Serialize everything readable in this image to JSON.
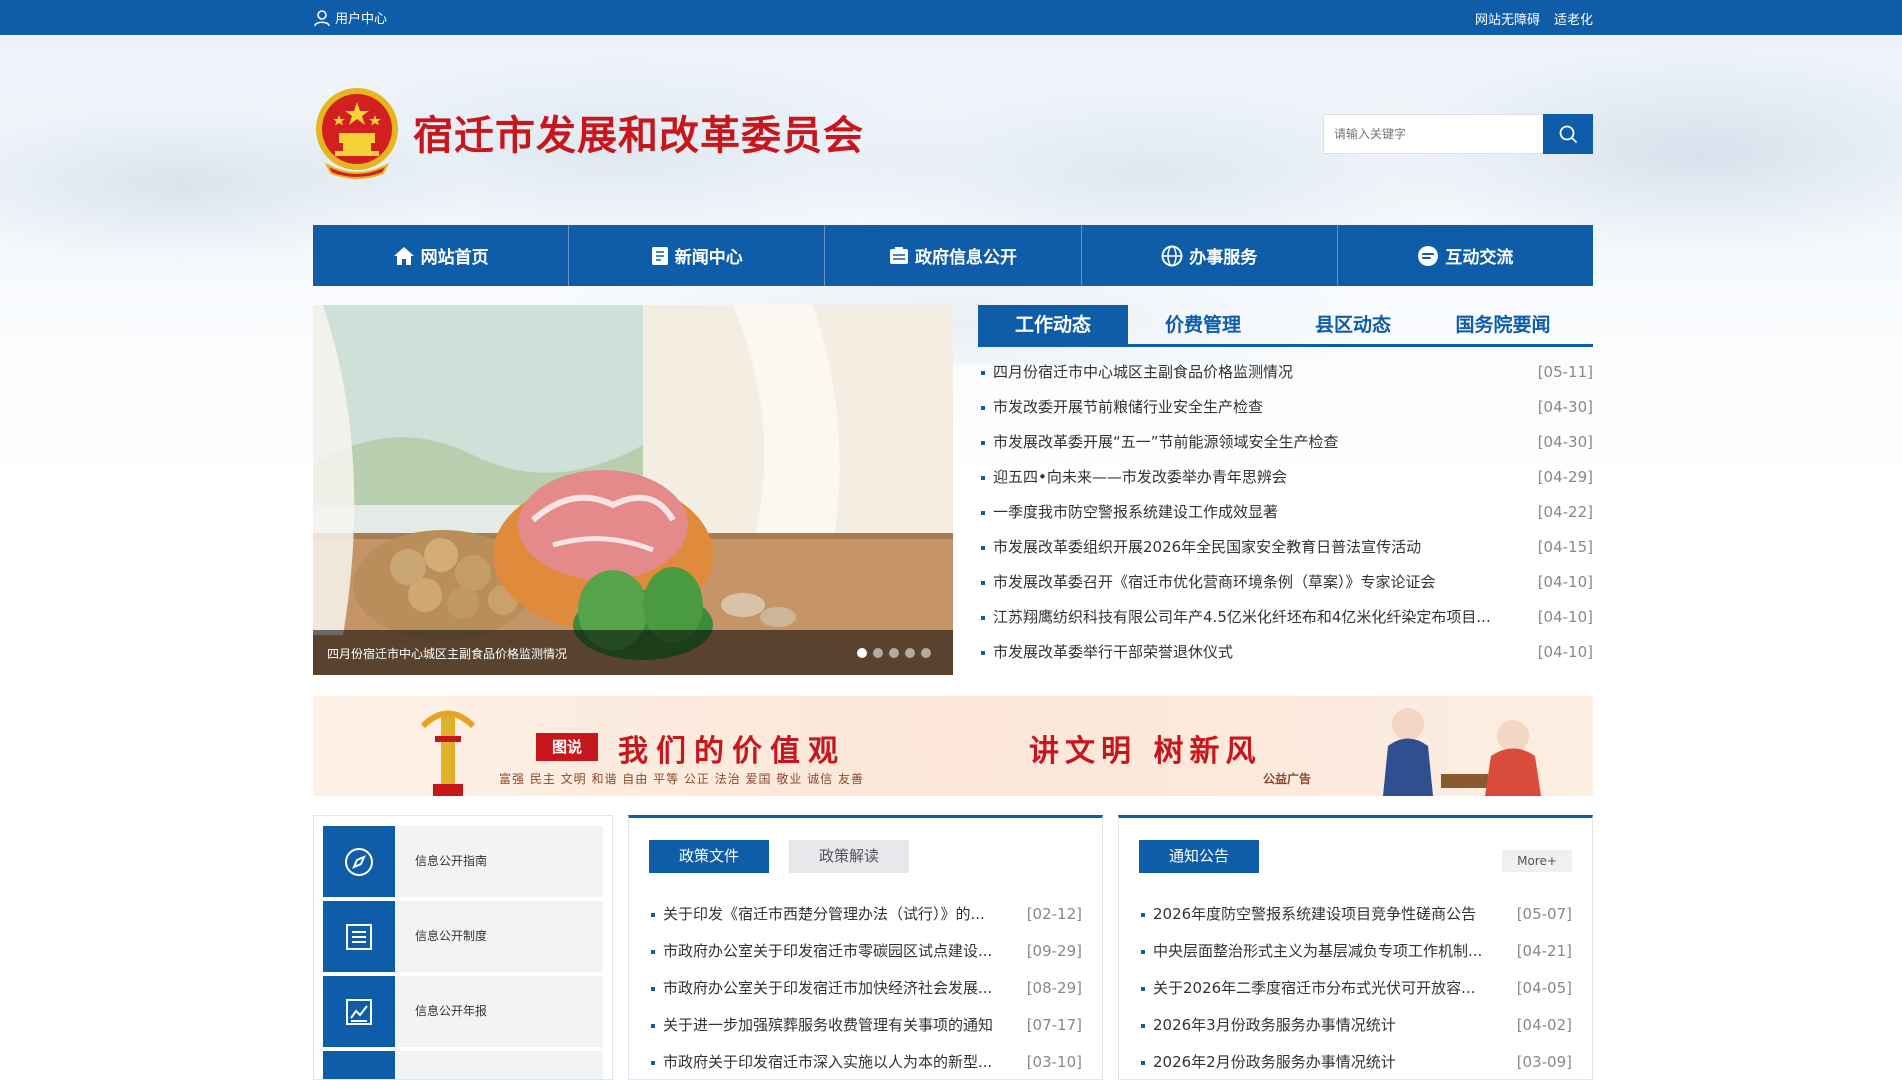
{
  "topbar": {
    "user_center": "用户中心",
    "accessibility": "网站无障碍",
    "elderly_mode": "适老化"
  },
  "header": {
    "site_title": "宿迁市发展和改革委员会",
    "search_placeholder": "请输入关键字"
  },
  "nav": [
    {
      "label": "网站首页",
      "icon": "home-icon"
    },
    {
      "label": "新闻中心",
      "icon": "document-icon"
    },
    {
      "label": "政府信息公开",
      "icon": "info-board-icon"
    },
    {
      "label": "办事服务",
      "icon": "globe-icon"
    },
    {
      "label": "互动交流",
      "icon": "chat-icon"
    }
  ],
  "slider": {
    "caption": "四月份宿迁市中心城区主副食品价格监测情况",
    "slide_count": 5,
    "active_index": 0
  },
  "news_tabs": [
    "工作动态",
    "价费管理",
    "县区动态",
    "国务院要闻"
  ],
  "news": [
    {
      "title": "四月份宿迁市中心城区主副食品价格监测情况",
      "date": "[05-11]"
    },
    {
      "title": "市发改委开展节前粮储行业安全生产检查",
      "date": "[04-30]"
    },
    {
      "title": "市发展改革委开展“五一”节前能源领域安全生产检查",
      "date": "[04-30]"
    },
    {
      "title": "迎五四•向未来——市发改委举办青年思辨会",
      "date": "[04-29]"
    },
    {
      "title": "一季度我市防空警报系统建设工作成效显著",
      "date": "[04-22]"
    },
    {
      "title": "市发展改革委组织开展2026年全民国家安全教育日普法宣传活动",
      "date": "[04-15]"
    },
    {
      "title": "市发展改革委召开《宿迁市优化营商环境条例（草案）》专家论证会",
      "date": "[04-10]"
    },
    {
      "title": "江苏翔鹰纺织科技有限公司年产4.5亿米化纤坯布和4亿米化纤染定布项目...",
      "date": "[04-10]"
    },
    {
      "title": "市发展改革委举行干部荣誉退休仪式",
      "date": "[04-10]"
    }
  ],
  "banner": {
    "badge": "图说",
    "slogan1": "我们的价值观",
    "values": "富强 民主 文明 和谐 自由 平等 公正 法治 爱国 敬业 诚信 友善",
    "slogan2": "讲文明 树新风",
    "psa": "公益广告"
  },
  "side_links": [
    {
      "label": "信息公开指南",
      "icon": "compass-icon"
    },
    {
      "label": "信息公开制度",
      "icon": "list-icon"
    },
    {
      "label": "信息公开年报",
      "icon": "report-icon"
    },
    {
      "label": "",
      "icon": "folder-icon"
    }
  ],
  "policy": {
    "tabs": [
      "政策文件",
      "政策解读"
    ],
    "items": [
      {
        "title": "关于印发《宿迁市西楚分管理办法（试行）》的...",
        "date": "[02-12]"
      },
      {
        "title": "市政府办公室关于印发宿迁市零碳园区试点建设...",
        "date": "[09-29]"
      },
      {
        "title": "市政府办公室关于印发宿迁市加快经济社会发展...",
        "date": "[08-29]"
      },
      {
        "title": "关于进一步加强殡葬服务收费管理有关事项的通知",
        "date": "[07-17]"
      },
      {
        "title": "市政府关于印发宿迁市深入实施以人为本的新型...",
        "date": "[03-10]"
      }
    ]
  },
  "notice": {
    "tab": "通知公告",
    "more": "More+",
    "items": [
      {
        "title": "2026年度防空警报系统建设项目竞争性磋商公告",
        "date": "[05-07]"
      },
      {
        "title": "中央层面整治形式主义为基层减负专项工作机制...",
        "date": "[04-21]"
      },
      {
        "title": "关于2026年二季度宿迁市分布式光伏可开放容...",
        "date": "[04-05]"
      },
      {
        "title": "2026年3月份政务服务办事情况统计",
        "date": "[04-02]"
      },
      {
        "title": "2026年2月份政务服务办事情况统计",
        "date": "[03-09]"
      }
    ]
  },
  "colors": {
    "primary": "#0f5ca8",
    "title_red": "#c8161d"
  }
}
